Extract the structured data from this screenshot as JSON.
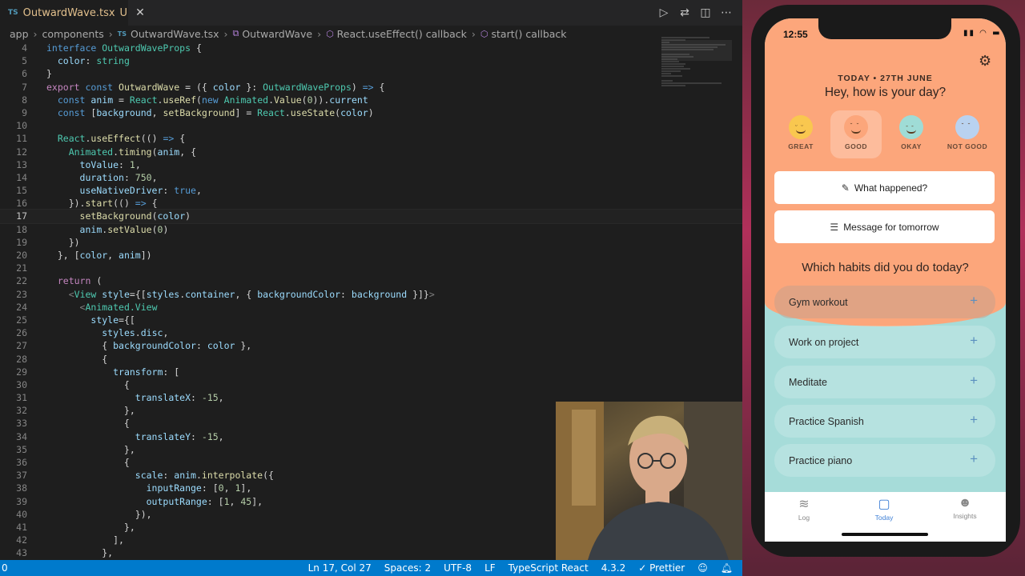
{
  "editor": {
    "tab": {
      "lang": "TS",
      "filename": "OutwardWave.tsx",
      "modified": "U",
      "close": "✕"
    },
    "breadcrumb": [
      "app",
      "components",
      "OutwardWave.tsx",
      "OutwardWave",
      "React.useEffect() callback",
      "start() callback"
    ],
    "breadcrumb_file_icon": "TS",
    "lines": [
      {
        "n": "4"
      },
      {
        "n": "5"
      },
      {
        "n": "6"
      },
      {
        "n": "7"
      },
      {
        "n": "8"
      },
      {
        "n": "9"
      },
      {
        "n": "10"
      },
      {
        "n": "11"
      },
      {
        "n": "12"
      },
      {
        "n": "13"
      },
      {
        "n": "14"
      },
      {
        "n": "15"
      },
      {
        "n": "16"
      },
      {
        "n": "17"
      },
      {
        "n": "18"
      },
      {
        "n": "19"
      },
      {
        "n": "20"
      },
      {
        "n": "21"
      },
      {
        "n": "22"
      },
      {
        "n": "23"
      },
      {
        "n": "24"
      },
      {
        "n": "25"
      },
      {
        "n": "26"
      },
      {
        "n": "27"
      },
      {
        "n": "28"
      },
      {
        "n": "29"
      },
      {
        "n": "30"
      },
      {
        "n": "31"
      },
      {
        "n": "32"
      },
      {
        "n": "33"
      },
      {
        "n": "34"
      },
      {
        "n": "35"
      },
      {
        "n": "36"
      },
      {
        "n": "37"
      },
      {
        "n": "38"
      },
      {
        "n": "39"
      },
      {
        "n": "40"
      },
      {
        "n": "41"
      },
      {
        "n": "42"
      },
      {
        "n": "43"
      }
    ]
  },
  "statusbar": {
    "left": "0",
    "position": "Ln 17, Col 27",
    "spaces": "Spaces: 2",
    "encoding": "UTF-8",
    "eol": "LF",
    "language": "TypeScript React",
    "version": "4.3.2",
    "prettier": "✓ Prettier"
  },
  "phone": {
    "time": "12:55",
    "date": "TODAY • 27TH JUNE",
    "greeting": "Hey, how is your day?",
    "moods": [
      {
        "label": "GREAT",
        "color": "#f9c74f"
      },
      {
        "label": "GOOD",
        "color": "#fca67b"
      },
      {
        "label": "OKAY",
        "color": "#9fdcd6"
      },
      {
        "label": "NOT GOOD",
        "color": "#b9d2f0"
      }
    ],
    "cards": [
      "What happened?",
      "Message for tomorrow"
    ],
    "habits_title": "Which habits did you do today?",
    "habits": [
      "Gym workout",
      "Work on project",
      "Meditate",
      "Practice Spanish",
      "Practice piano"
    ],
    "tabs": [
      "Log",
      "Today",
      "Insights"
    ],
    "colors": {
      "top": "#fca67b",
      "bottom": "#a6dcd9",
      "accent": "#3f80d6"
    }
  }
}
